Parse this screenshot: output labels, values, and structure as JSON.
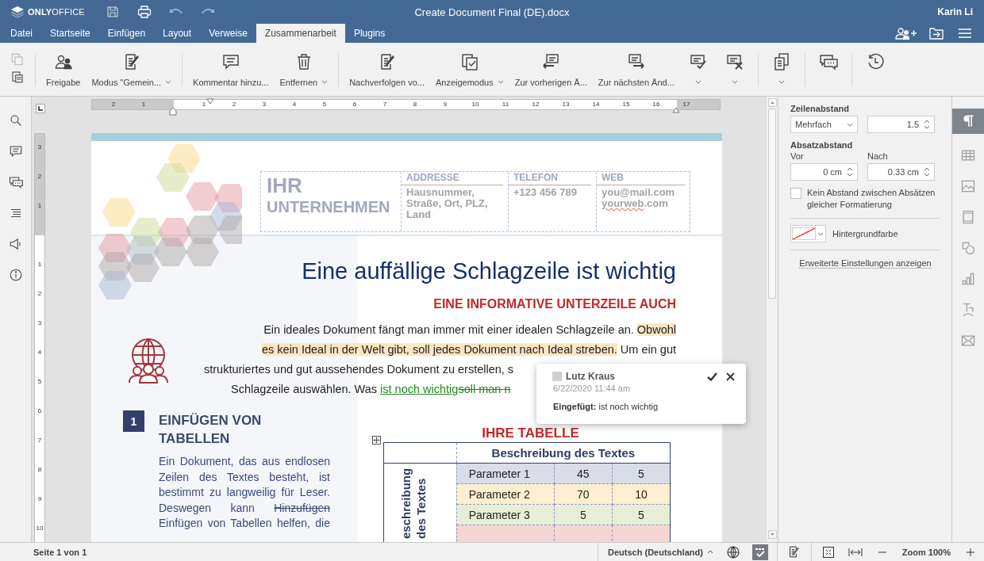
{
  "title_bar": {
    "app_name_bold": "ONLY",
    "app_name_light": "OFFICE",
    "title": "Create Document Final (DE).docx",
    "user": "Karin Li"
  },
  "menu_tabs": [
    {
      "label": "Datei",
      "selected": false
    },
    {
      "label": "Startseite",
      "selected": false
    },
    {
      "label": "Einfügen",
      "selected": false
    },
    {
      "label": "Layout",
      "selected": false
    },
    {
      "label": "Verweise",
      "selected": false
    },
    {
      "label": "Zusammenarbeit",
      "selected": true
    },
    {
      "label": "Plugins",
      "selected": false
    }
  ],
  "toolbar": {
    "clipboard": [
      {
        "kind": "copy",
        "disabled": true
      },
      {
        "kind": "paste",
        "disabled": false
      }
    ],
    "groups": [
      [
        {
          "kind": "share",
          "label": "Freigabe",
          "has_caret": false
        },
        {
          "kind": "coedit",
          "label": "Modus \"Gemein...",
          "has_caret": true
        }
      ],
      [
        {
          "kind": "comment",
          "label": "Kommentar hinzu...",
          "has_caret": false
        },
        {
          "kind": "trash",
          "label": "Entfernen",
          "has_caret": true
        }
      ],
      [
        {
          "kind": "track",
          "label": "Nachverfolgen vo...",
          "has_caret": false
        },
        {
          "kind": "display",
          "label": "Anzeigemodus",
          "has_caret": true
        },
        {
          "kind": "previous",
          "label": "Zur vorherigen Ä...",
          "has_caret": false
        },
        {
          "kind": "next",
          "label": "Zur nächsten Änd...",
          "has_caret": false
        },
        {
          "kind": "accept",
          "has_caret": true
        },
        {
          "kind": "reject",
          "has_caret": true
        }
      ],
      [
        {
          "kind": "compare",
          "has_caret": true
        }
      ],
      [
        {
          "kind": "chat",
          "has_caret": false
        }
      ],
      [
        {
          "kind": "history",
          "has_caret": false
        }
      ]
    ]
  },
  "left_sidebar": [
    {
      "kind": "search"
    },
    {
      "kind": "comments"
    },
    {
      "kind": "chat"
    },
    {
      "kind": "navigation"
    },
    {
      "kind": "feedback"
    },
    {
      "kind": "about"
    }
  ],
  "ruler": {
    "top_before": [
      "2",
      "1"
    ],
    "top_after": [
      "1",
      "2",
      "3",
      "4",
      "5",
      "6",
      "7",
      "8",
      "9",
      "10",
      "11",
      "12",
      "13",
      "14",
      "15",
      "16",
      "17"
    ],
    "left_before": [
      "3",
      "2",
      "1"
    ],
    "left_after": [
      "1",
      "2",
      "3",
      "4",
      "5",
      "6",
      "7",
      "8",
      "9",
      "10"
    ]
  },
  "document": {
    "company": {
      "line_1": "IHR",
      "line_2": "UNTERNEHMEN"
    },
    "contact_columns": [
      {
        "heading": "ADDRESSE",
        "lines": [
          [
            {
              "kind": "normal",
              "text": "Hausnummer, Straße, Ort, PLZ, Land"
            }
          ]
        ]
      },
      {
        "heading": "TELEFON",
        "lines": [
          [
            {
              "kind": "normal",
              "text": "+123 456 789"
            }
          ]
        ]
      },
      {
        "heading": "WEB",
        "lines": [
          [
            {
              "kind": "normal",
              "text": "you@mail.com"
            }
          ],
          [
            {
              "kind": "misspelled",
              "text": "yourweb"
            },
            {
              "kind": "normal",
              "text": ".com"
            }
          ]
        ]
      }
    ],
    "headline": "Eine auffällige Schlagzeile ist wichtig",
    "subheadline": "EINE INFORMATIVE UNTERZEILE AUCH",
    "intro_lines": [
      [
        {
          "kind": "normal",
          "text": "Ein ideales Dokument fängt man immer mit einer idealen Schlagzeile an. "
        },
        {
          "kind": "highlight",
          "text": "Obwohl"
        }
      ],
      [
        {
          "kind": "highlight",
          "text": "es kein Ideal in der Welt gibt, soll jedes Dokument nach Ideal streben."
        },
        {
          "kind": "normal",
          "text": " Um ein gut"
        }
      ],
      [
        {
          "kind": "normal",
          "text": "strukturiertes und gut aussehendes Dokument zu erstellen, s"
        }
      ],
      [
        {
          "kind": "normal",
          "text": "Schlagzeile auswählen. Was "
        },
        {
          "kind": "inserted",
          "text": "ist noch wichtig"
        },
        {
          "kind": "deleted",
          "text": "soll man n"
        }
      ]
    ],
    "section": {
      "number": "1",
      "heading": "EINFÜGEN VON TABELLEN",
      "body": [
        {
          "kind": "normal",
          "text": "Ein Dokument, das aus endlosen Zeilen des Textes besteht, ist bestimmt zu langweilig für Leser. Deswegen kann "
        },
        {
          "kind": "deleted",
          "text": "Hinzufügen"
        },
        {
          "kind": "normal",
          "text": " Einfügen von Tabellen helfen, die"
        }
      ]
    },
    "table_title": "IHRE TABELLE",
    "table": {
      "header": "Beschreibung des Textes",
      "side_header": "eschreibung des Textes",
      "rows": [
        {
          "color": "#d9dde9",
          "cells": [
            "Parameter 1",
            "45",
            "5"
          ]
        },
        {
          "color": "#fdefcf",
          "cells": [
            "Parameter 2",
            "70",
            "10"
          ]
        },
        {
          "color": "#e6efd6",
          "cells": [
            "Parameter 3",
            "5",
            "5"
          ]
        },
        {
          "color": "#f6d5d5"
        }
      ]
    }
  },
  "comment": {
    "author": "Lutz Kraus",
    "date": "6/22/2020 11:44 am",
    "text": "**Eingefügt:** ist noch wichtig"
  },
  "right_panel": {
    "line_spacing_label": "Zeilenabstand",
    "line_spacing_mode": "Mehrfach",
    "line_spacing_value": "1.5",
    "paragraph_spacing_label": "Absatzabstand",
    "before_label": "Vor",
    "before_value": "0 cm",
    "after_label": "Nach",
    "after_value": "0.33 cm",
    "no_spacing_label": "Kein Abstand zwischen Absätzen gleicher Formatierung",
    "no_spacing_checked": false,
    "background_label": "Hintergrundfarbe",
    "advanced_link": "Erweiterte Einstellungen anzeigen"
  },
  "right_tabs": [
    {
      "kind": "paragraph",
      "selected": true
    },
    {
      "kind": "table",
      "selected": false
    },
    {
      "kind": "image",
      "selected": false
    },
    {
      "kind": "header",
      "selected": false
    },
    {
      "kind": "shape",
      "selected": false
    },
    {
      "kind": "chart",
      "selected": false
    },
    {
      "kind": "textart",
      "selected": false
    },
    {
      "kind": "mailmerge",
      "selected": false
    }
  ],
  "status_bar": {
    "page_info": "Seite 1 von 1",
    "language": "Deutsch (Deutschland)",
    "spellcheck_on": true,
    "zoom": "Zoom 100%"
  }
}
